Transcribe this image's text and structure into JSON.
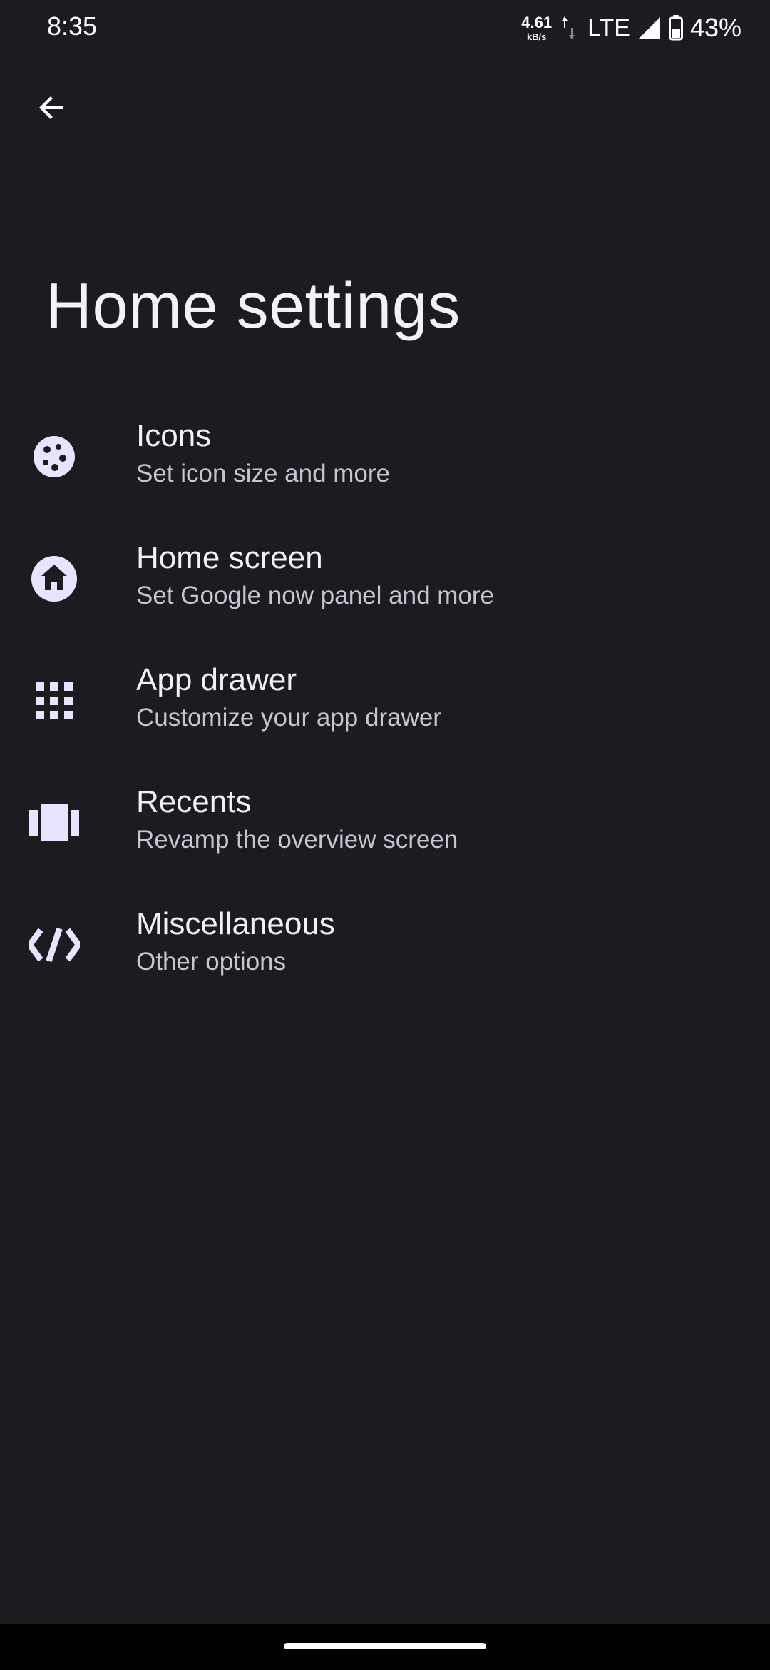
{
  "status_bar": {
    "time": "8:35",
    "net_speed": "4.61",
    "net_unit": "kB/s",
    "network": "LTE",
    "battery": "43%"
  },
  "header": {
    "title": "Home settings"
  },
  "items": [
    {
      "icon": "cookie-icon",
      "title": "Icons",
      "subtitle": "Set icon size and more"
    },
    {
      "icon": "home-icon",
      "title": "Home screen",
      "subtitle": "Set Google now panel and more"
    },
    {
      "icon": "grid-icon",
      "title": "App drawer",
      "subtitle": "Customize your app drawer"
    },
    {
      "icon": "recents-icon",
      "title": "Recents",
      "subtitle": "Revamp the overview screen"
    },
    {
      "icon": "code-icon",
      "title": "Miscellaneous",
      "subtitle": "Other options"
    }
  ],
  "colors": {
    "background": "#1c1b20",
    "icon_tint": "#e9e3ff",
    "title_text": "#f3f0f8",
    "subtitle_text": "#c9c4d2"
  }
}
